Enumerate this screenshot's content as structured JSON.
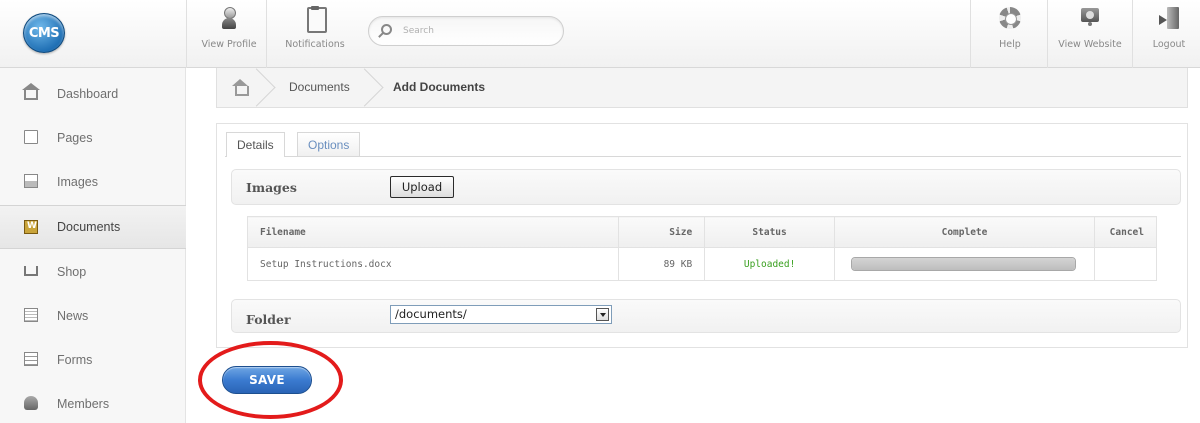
{
  "header": {
    "logo_text": "CMS",
    "view_profile_label": "View Profile",
    "notifications_label": "Notifications",
    "search_placeholder": "Search",
    "help_label": "Help",
    "view_website_label": "View Website",
    "logout_label": "Logout"
  },
  "sidebar": {
    "items": [
      {
        "label": "Dashboard",
        "icon": "home-icon"
      },
      {
        "label": "Pages",
        "icon": "page-icon"
      },
      {
        "label": "Images",
        "icon": "image-icon"
      },
      {
        "label": "Documents",
        "icon": "document-icon",
        "active": true
      },
      {
        "label": "Shop",
        "icon": "cart-icon"
      },
      {
        "label": "News",
        "icon": "news-icon"
      },
      {
        "label": "Forms",
        "icon": "form-icon"
      },
      {
        "label": "Members",
        "icon": "members-icon"
      }
    ]
  },
  "breadcrumb": {
    "items": [
      "Documents",
      "Add Documents"
    ]
  },
  "tabs": {
    "details": "Details",
    "options": "Options"
  },
  "images_section": {
    "label": "Images",
    "upload_label": "Upload"
  },
  "file_table": {
    "columns": [
      "Filename",
      "Size",
      "Status",
      "Complete",
      "Cancel"
    ],
    "rows": [
      {
        "filename": "Setup Instructions.docx",
        "size": "89 KB",
        "status": "Uploaded!",
        "complete_fraction": 1.0
      }
    ]
  },
  "folder_section": {
    "label": "Folder",
    "selected": "/documents/"
  },
  "save_label": "SAVE",
  "colors": {
    "accent": "#3b7bd0",
    "status_ok": "#3aa020",
    "highlight": "#e31b1b"
  }
}
